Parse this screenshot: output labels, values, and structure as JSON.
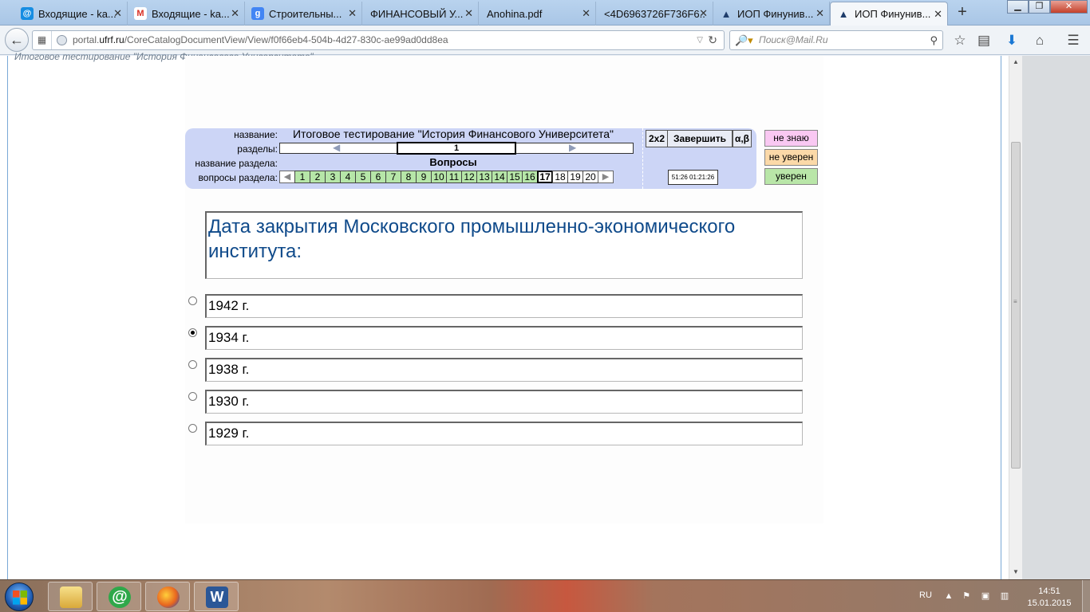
{
  "browser": {
    "tabs": [
      {
        "label": "Входящие - ka...",
        "icon": "mailru-icon",
        "icon_color": "#168de2"
      },
      {
        "label": "Входящие - ka...",
        "icon": "gmail-icon",
        "icon_color": "#d93025"
      },
      {
        "label": "Строительны...",
        "icon": "google-icon",
        "icon_color": "#4285f4"
      },
      {
        "label": "ФИНАНСОВЫЙ У...",
        "icon": "",
        "icon_color": ""
      },
      {
        "label": "Anohina.pdf",
        "icon": "",
        "icon_color": ""
      },
      {
        "label": "<4D6963726F736F6...",
        "icon": "",
        "icon_color": ""
      },
      {
        "label": "ИОП Финунив...",
        "icon": "graduation-cap-icon",
        "icon_color": "#1f3d6b"
      },
      {
        "label": "ИОП Финунив...",
        "icon": "graduation-cap-icon",
        "icon_color": "#1f3d6b",
        "active": true
      }
    ],
    "new_tab": "+",
    "url_host": "portal.",
    "url_domain": "ufrf.ru",
    "url_path": "/CoreCatalogDocumentView/View/f0f66eb4-504b-4d27-830c-ae99ad0dd8ea",
    "search_placeholder": "Поиск@Mail.Ru"
  },
  "page": {
    "cut_off_text": "Итоговое тестирование \"История Финансового Университета\"",
    "labels": {
      "name": "название:",
      "sections": "разделы:",
      "section_name": "название раздела:",
      "section_questions": "вопросы раздела:"
    },
    "test_title": "Итоговое тестирование \"История Финансового Университета\"",
    "current_section": "1",
    "section_title": "Вопросы",
    "questions": [
      {
        "n": "1",
        "state": "answered"
      },
      {
        "n": "2",
        "state": "answered"
      },
      {
        "n": "3",
        "state": "answered"
      },
      {
        "n": "4",
        "state": "answered"
      },
      {
        "n": "5",
        "state": "answered"
      },
      {
        "n": "6",
        "state": "answered"
      },
      {
        "n": "7",
        "state": "answered"
      },
      {
        "n": "8",
        "state": "answered"
      },
      {
        "n": "9",
        "state": "answered"
      },
      {
        "n": "10",
        "state": "answered"
      },
      {
        "n": "11",
        "state": "answered"
      },
      {
        "n": "12",
        "state": "answered"
      },
      {
        "n": "13",
        "state": "answered"
      },
      {
        "n": "14",
        "state": "answered"
      },
      {
        "n": "15",
        "state": "answered"
      },
      {
        "n": "16",
        "state": "answered"
      },
      {
        "n": "17",
        "state": "current"
      },
      {
        "n": "18",
        "state": "open"
      },
      {
        "n": "19",
        "state": "open"
      },
      {
        "n": "20",
        "state": "open"
      }
    ],
    "buttons": {
      "grid": "2x2",
      "finish": "Завершить",
      "alpha_beta": "α,β"
    },
    "timer": "51:26 01:21:26",
    "confidence": [
      {
        "label": "не знаю",
        "color": "#f9c8f2"
      },
      {
        "label": "не уверен",
        "color": "#fbd9a8"
      },
      {
        "label": "уверен",
        "color": "#b9e6a8"
      }
    ],
    "question_text": "Дата закрытия Московского промышленно-экономического института:",
    "answers": [
      {
        "text": "1942 г.",
        "selected": false
      },
      {
        "text": "1934 г.",
        "selected": true
      },
      {
        "text": "1938 г.",
        "selected": false
      },
      {
        "text": "1930 г.",
        "selected": false
      },
      {
        "text": "1929 г.",
        "selected": false
      }
    ]
  },
  "taskbar": {
    "language": "RU",
    "time": "14:51",
    "date": "15.01.2015",
    "apps": [
      {
        "name": "file-explorer",
        "color": "#e8c25a"
      },
      {
        "name": "mail-agent",
        "color": "#2fa84a"
      },
      {
        "name": "firefox",
        "color": "#e8661f"
      },
      {
        "name": "word",
        "color": "#2b5797"
      }
    ]
  }
}
